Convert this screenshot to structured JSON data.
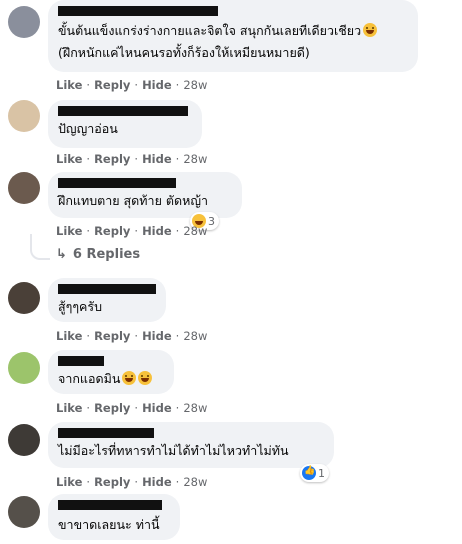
{
  "comments": [
    {
      "line1": "ขั้นต้นแข็งแกร่งร่างกายและจิตใจ สนุกกันเลยทีเดียวเชียว",
      "line2": "(ฝึกหนักแค่ไหนคนรอทั้งก็ร้องให้เหมียนหมายดี)",
      "like": "Like",
      "reply": "Reply",
      "hide": "Hide",
      "time": "28w"
    },
    {
      "line1": "ปัญญาอ่อน",
      "like": "Like",
      "reply": "Reply",
      "hide": "Hide",
      "time": "28w"
    },
    {
      "line1": "ฝึกแทบตาย สุดท้าย ตัดหญ้า",
      "like": "Like",
      "reply": "Reply",
      "hide": "Hide",
      "time": "28w",
      "reaction_count": "3",
      "replies_label": "6 Replies"
    },
    {
      "line1": "สู้ๆๆครับ",
      "like": "Like",
      "reply": "Reply",
      "hide": "Hide",
      "time": "28w"
    },
    {
      "line1": "จากแอดมิน",
      "like": "Like",
      "reply": "Reply",
      "hide": "Hide",
      "time": "28w"
    },
    {
      "line1": "ไม่มีอะไรที่ทหารทำไม่ได้ทำไม่ไหวทำไม่ทัน",
      "like": "Like",
      "reply": "Reply",
      "hide": "Hide",
      "time": "28w",
      "reaction_count": "1"
    },
    {
      "line1": "ขาขาดเลยนะ ท่านี้"
    }
  ],
  "colors": {
    "bubble": "#f0f2f5",
    "meta": "#65676b",
    "text": "#050505",
    "like_blue": "#1877f2"
  },
  "icons": {
    "reply_arrow": "reply-arrow-icon",
    "haha": "haha-reaction-icon",
    "like": "like-reaction-icon"
  }
}
